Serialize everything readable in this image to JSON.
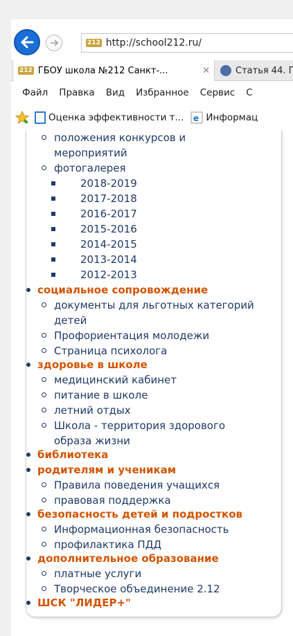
{
  "browser": {
    "url": "http://school212.ru/",
    "site_icon": "212",
    "tabs": [
      {
        "label": "ГБОУ школа №212 Санкт-...",
        "close": "✕",
        "active": true
      },
      {
        "label": "Статья 44. П",
        "active": false
      }
    ],
    "menu": [
      "Файл",
      "Правка",
      "Вид",
      "Избранное",
      "Сервис",
      "С"
    ],
    "favorites": [
      {
        "label": "Оценка эффективности т...",
        "icon": "document-icon"
      },
      {
        "label": "Информац",
        "icon": "ie-icon"
      }
    ]
  },
  "nav": {
    "line1": "положения конкурсов и",
    "line2": "мероприятий",
    "photo": "фотогалерея",
    "years": [
      "2018-2019",
      "2017-2018",
      "2016-2017",
      "2015-2016",
      "2014-2015",
      "2013-2014",
      "2012-2013"
    ],
    "social": "социальное сопровождение",
    "social_items": [
      "документы для льготных категорий",
      "детей",
      "Профориентация молодежи",
      "Страница психолога"
    ],
    "health": "здоровье в школе",
    "health_items": [
      "медицинский кабинет",
      "питание в школе",
      "летний отдых",
      "Школа - территория здорового",
      "образа жизни"
    ],
    "library": "библиотека",
    "parents": "родителям и ученикам",
    "parents_items": [
      "Правила поведения учащихся",
      "правовая поддержка"
    ],
    "safety": "безопасность детей и подростков",
    "safety_items": [
      "Информационная безопасность",
      "профилактика ПДД"
    ],
    "extra": "дополнительное образование",
    "extra_items": [
      "платные услуги",
      "Творческое объединение 2.12"
    ],
    "sport": "ШСК \"ЛИДЕР+\""
  },
  "colors": {
    "section": "#d35400",
    "link": "#1f3a66",
    "back_button": "#1a6fd6"
  }
}
